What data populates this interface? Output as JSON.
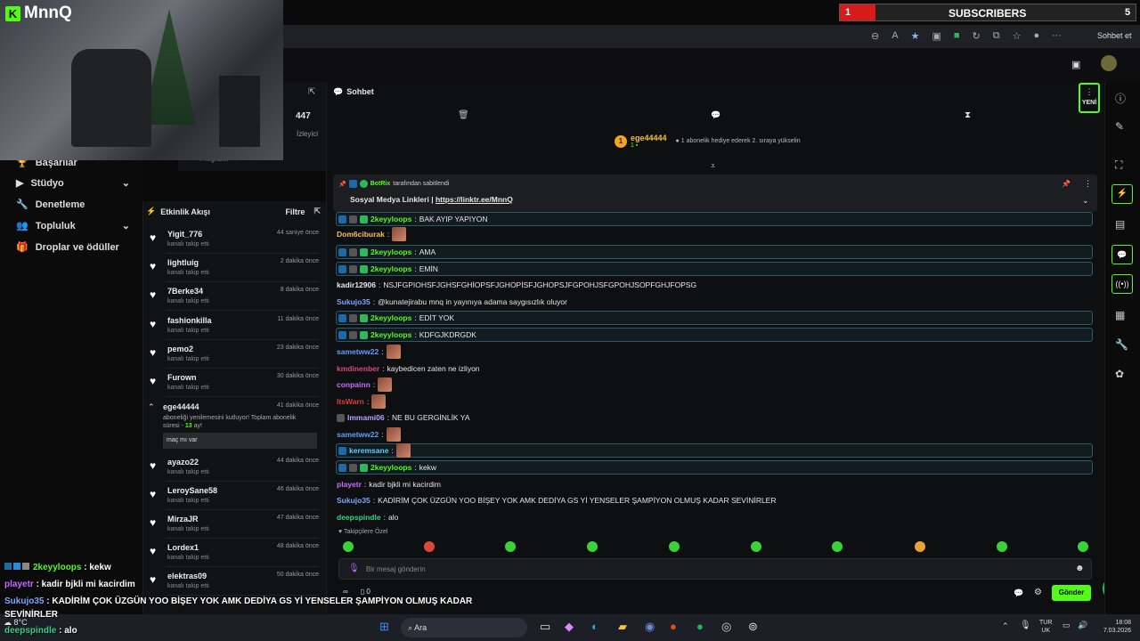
{
  "brand": {
    "name": "MnnQ",
    "logo_letter": "K",
    "color": "#53fc18"
  },
  "subscribers": {
    "current": "1",
    "label": "SUBSCRIBERS",
    "goal": "5"
  },
  "browser": {
    "copilot_label": "Sohbet et"
  },
  "stats": {
    "viewers": "447",
    "viewers_label": "İzleyici",
    "program_label": "Programı"
  },
  "nav": [
    {
      "label": "Başarılar",
      "icon": "trophy-icon"
    },
    {
      "label": "Stüdyo",
      "icon": "video-icon",
      "chevron": true
    },
    {
      "label": "Denetleme",
      "icon": "wrench-icon"
    },
    {
      "label": "Topluluk",
      "icon": "people-icon",
      "chevron": true
    },
    {
      "label": "Droplar ve ödüller",
      "icon": "gift-icon"
    }
  ],
  "feed": {
    "title": "Etkinlik Akışı",
    "filter_label": "Filtre",
    "items": [
      {
        "name": "Yigit_776",
        "action": "kanalı takip etti",
        "time": "44 saniye önce"
      },
      {
        "name": "lightluig",
        "action": "kanalı takip etti",
        "time": "2 dakika önce"
      },
      {
        "name": "7Berke34",
        "action": "kanalı takip etti",
        "time": "8 dakika önce"
      },
      {
        "name": "fashionkilla",
        "action": "kanalı takip etti",
        "time": "11 dakika önce"
      },
      {
        "name": "pemo2",
        "action": "kanalı takip etti",
        "time": "23 dakika önce"
      },
      {
        "name": "Furown",
        "action": "kanalı takip etti",
        "time": "30 dakika önce"
      }
    ],
    "sub_item": {
      "name": "ege44444",
      "time": "41 dakika önce",
      "text1": "aboneliği yenilemesini kutluyor! Toplam abonelik",
      "text2": "süresi - ",
      "months": "13",
      "text3": " ay!",
      "message": "maç mı var"
    },
    "items2": [
      {
        "name": "ayazo22",
        "action": "kanalı takip etti",
        "time": "44 dakika önce"
      },
      {
        "name": "LeroySane58",
        "action": "kanalı takip etti",
        "time": "46 dakika önce"
      },
      {
        "name": "MirzaJR",
        "action": "kanalı takip etti",
        "time": "47 dakika önce"
      },
      {
        "name": "Lordex1",
        "action": "kanalı takip etti",
        "time": "48 dakika önce"
      },
      {
        "name": "elektras09",
        "action": "kanalı takip etti",
        "time": "50 dakika önce"
      }
    ]
  },
  "chat": {
    "title": "Sohbet",
    "new_label": "YENİ",
    "gifter": {
      "name": "ege44444",
      "badge_count": "1",
      "rank_num": "1",
      "message": "1 abonelik hediye ederek 2. sıraya yükselin"
    },
    "pinned": {
      "by_user": "BotRix",
      "by_text": "tarafından sabitlendi",
      "title": "Sosyal Medya Linkleri",
      "link": "https://linktr.ee/MnnQ"
    },
    "messages": [
      {
        "user": "2keyyloops",
        "text": "BAK AYIP YAPIYON",
        "color": "#53fc18",
        "boxed": true,
        "badges": true
      },
      {
        "user": "Dom6ciburak",
        "text": "",
        "color": "#f0c060",
        "emote": true
      },
      {
        "user": "2keyyloops",
        "text": "AMA",
        "color": "#53fc18",
        "boxed": true,
        "badges": true
      },
      {
        "user": "2keyyloops",
        "text": "EMİN",
        "color": "#53fc18",
        "boxed": true,
        "badges": true
      },
      {
        "user": "kadir12906",
        "text": "NSJFGPIOHSFJGHSFGHİOPSFJGHOPİSFJGHOPSJFGPOHJSFGPOHJSOPFGHJFOPSG",
        "color": "#e8e8e8"
      },
      {
        "user": "Sukujo35",
        "text": "@kunatejirabu mnq in yayınıya adama saygısızlık oluyor",
        "color": "#7aa7ff"
      },
      {
        "user": "2keyyloops",
        "text": "EDİT YOK",
        "color": "#53fc18",
        "boxed": true,
        "badges": true
      },
      {
        "user": "2keyyloops",
        "text": "KDFGJKDRGDK",
        "color": "#53fc18",
        "boxed": true,
        "badges": true
      },
      {
        "user": "sametww22",
        "text": "",
        "color": "#5aa0ff",
        "emote": true
      },
      {
        "user": "kmdinenber",
        "text": "kaybedicen zaten ne izliyon",
        "color": "#e0457a"
      },
      {
        "user": "conpainn",
        "text": "",
        "color": "#c86cff",
        "emote": true
      },
      {
        "user": "ItsWarn",
        "text": "",
        "color": "#e03a3a",
        "emote": true
      },
      {
        "user": "Immami06",
        "text": "NE BU GERGİNLİK YA",
        "color": "#b9a5ff",
        "smallbadge": true
      },
      {
        "user": "sametww22",
        "text": "",
        "color": "#5aa0ff",
        "emote": true
      },
      {
        "user": "keremsane",
        "text": "",
        "color": "#5ad0ff",
        "boxed": true,
        "emote": true,
        "kickonly": true
      },
      {
        "user": "2keyyloops",
        "text": "kekw",
        "color": "#53fc18",
        "boxed": true,
        "badges": true
      },
      {
        "user": "playetr",
        "text": "kadir bjkli mi kacirdim",
        "color": "#c86cff"
      },
      {
        "user": "Sukujo35",
        "text": "KADİRİM ÇOK ÜZGÜN YOO BİŞEY YOK AMK DEDİYA GS Yİ YENSELER ŞAMPİYON OLMUŞ KADAR SEVİNİRLER",
        "color": "#7aa7ff"
      },
      {
        "user": "deepspindle",
        "text": "alo",
        "color": "#3ad18a"
      }
    ],
    "followers_only": "Takipçilere Özel",
    "input_placeholder": "Bir mesaj gönderin",
    "send_label": "Gönder",
    "points": "0"
  },
  "overlay": {
    "lines": [
      {
        "user": "2keyyloops",
        "text": " : kekw",
        "color": "#53fc18"
      },
      {
        "user": "playetr",
        "text": " : kadir bjkli mi kacirdim",
        "color": "#c86cff"
      },
      {
        "user": "Sukujo35",
        "text": " : KADİRİM ÇOK ÜZGÜN YOO BİŞEY YOK AMK DEDİYA GS Yİ YENSELER ŞAMPİYON OLMUŞ KADAR",
        "color": "#7aa7ff"
      },
      {
        "user": "",
        "text": "SEVİNİRLER",
        "color": "#fff"
      },
      {
        "user": "deepspindle",
        "text": " : alo",
        "color": "#3ad18a"
      }
    ]
  },
  "taskbar": {
    "search": "Ara",
    "weather": "8°C",
    "lang1": "TUR",
    "lang2": "UK",
    "time": "18:08",
    "date": "7.03.2026"
  }
}
